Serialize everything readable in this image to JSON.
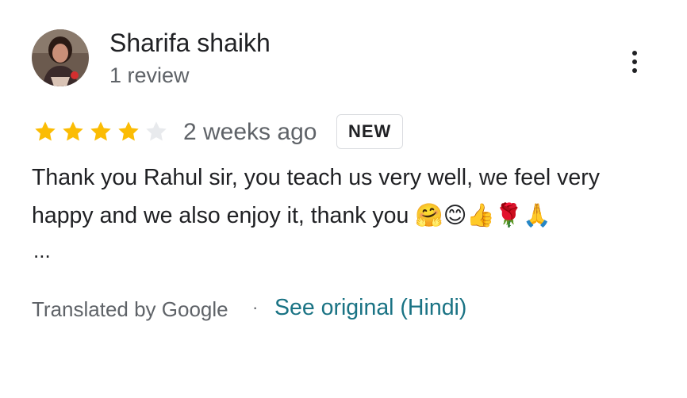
{
  "reviewer": {
    "name": "Sharifa shaikh",
    "review_count": "1 review"
  },
  "rating": {
    "value": 4,
    "max": 5
  },
  "time_ago": "2 weeks ago",
  "badge": "NEW",
  "review_text": "Thank you Rahul sir, you teach us very well, we feel very happy and we also enjoy it, thank you 🤗😊👍🌹🙏",
  "ellipsis": "...",
  "translation": {
    "label": "Translated by Google",
    "separator": "·",
    "link": "See original (Hindi)"
  },
  "colors": {
    "star_filled": "#fbbc04",
    "star_empty": "#e8eaed",
    "link": "#1a7384",
    "secondary_text": "#5f6368"
  }
}
